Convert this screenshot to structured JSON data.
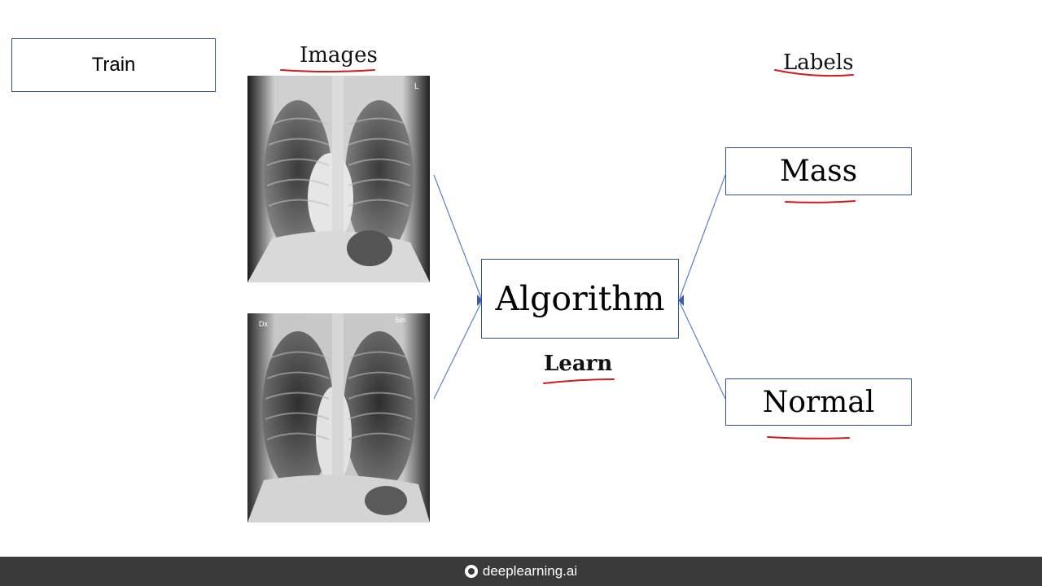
{
  "train_label": "Train",
  "images_heading": "Images",
  "labels_heading": "Labels",
  "algorithm_label": "Algorithm",
  "learn_label": "Learn",
  "mass_label": "Mass",
  "normal_label": "Normal",
  "xray_top": {
    "marker": "L"
  },
  "xray_bottom": {
    "left_marker": "Dx",
    "right_marker": "Sin"
  },
  "footer": {
    "brand": "deeplearning.ai"
  },
  "colors": {
    "box_border": "#2f4f8f",
    "connector": "#5b7fc7",
    "annotation": "#d11a1a",
    "footer_bg": "#3a3a3a"
  }
}
